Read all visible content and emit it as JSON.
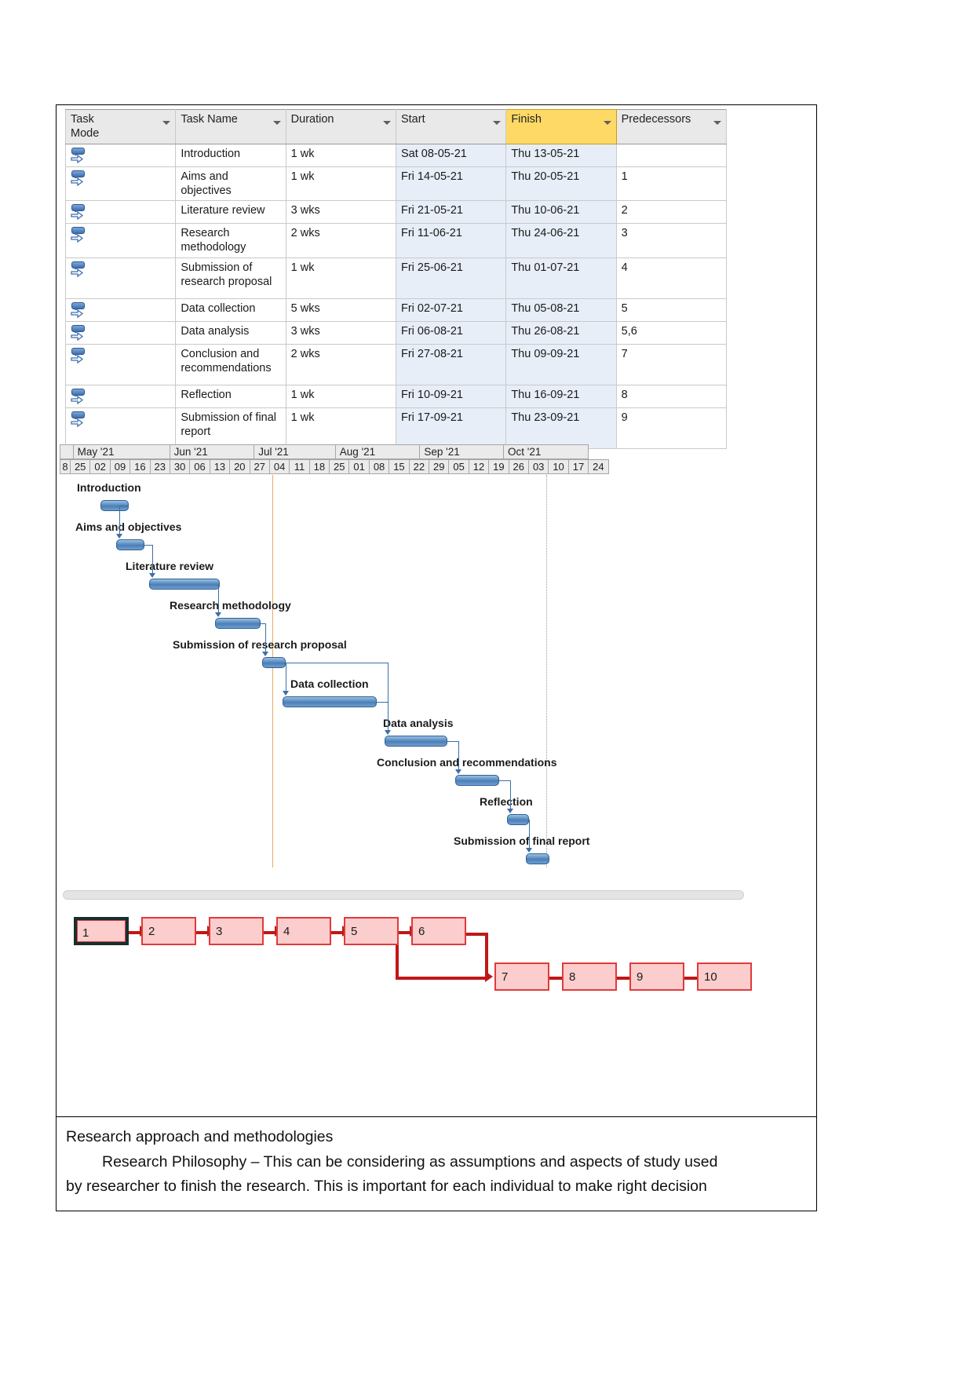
{
  "grid": {
    "columns": [
      {
        "label": "Task\nMode",
        "selected": false
      },
      {
        "label": "Task Name",
        "selected": false
      },
      {
        "label": "Duration",
        "selected": false
      },
      {
        "label": "Start",
        "selected": false
      },
      {
        "label": "Finish",
        "selected": true
      },
      {
        "label": "Predecessors",
        "selected": false
      }
    ],
    "rows": [
      {
        "name": "Introduction",
        "duration": "1 wk",
        "start": "Sat 08-05-21",
        "finish": "Thu 13-05-21",
        "pred": ""
      },
      {
        "name": "Aims and objectives",
        "duration": "1 wk",
        "start": "Fri 14-05-21",
        "finish": "Thu 20-05-21",
        "pred": "1"
      },
      {
        "name": "Literature review",
        "duration": "3 wks",
        "start": "Fri 21-05-21",
        "finish": "Thu 10-06-21",
        "pred": "2"
      },
      {
        "name": "Research methodology",
        "duration": "2 wks",
        "start": "Fri 11-06-21",
        "finish": "Thu 24-06-21",
        "pred": "3"
      },
      {
        "name": "Submission of research proposal",
        "duration": "1 wk",
        "start": "Fri 25-06-21",
        "finish": "Thu 01-07-21",
        "pred": "4"
      },
      {
        "name": "Data collection",
        "duration": "5 wks",
        "start": "Fri 02-07-21",
        "finish": "Thu 05-08-21",
        "pred": "5"
      },
      {
        "name": "Data analysis",
        "duration": "3 wks",
        "start": "Fri 06-08-21",
        "finish": "Thu 26-08-21",
        "pred": "5,6"
      },
      {
        "name": "Conclusion and recommendations",
        "duration": "2 wks",
        "start": "Fri 27-08-21",
        "finish": "Thu 09-09-21",
        "pred": "7"
      },
      {
        "name": "Reflection",
        "duration": "1 wk",
        "start": "Fri 10-09-21",
        "finish": "Thu 16-09-21",
        "pred": "8"
      },
      {
        "name": "Submission of final report",
        "duration": "1 wk",
        "start": "Fri 17-09-21",
        "finish": "Thu 23-09-21",
        "pred": "9"
      }
    ]
  },
  "gantt": {
    "months": [
      "May '21",
      "Jun '21",
      "Jul '21",
      "Aug '21",
      "Sep '21",
      "Oct '21"
    ],
    "weeks": [
      "8",
      "25",
      "02",
      "09",
      "16",
      "23",
      "30",
      "06",
      "13",
      "20",
      "27",
      "04",
      "11",
      "18",
      "25",
      "01",
      "08",
      "15",
      "22",
      "29",
      "05",
      "12",
      "19",
      "26",
      "03",
      "10",
      "17",
      "24"
    ],
    "bars": [
      {
        "label": "Introduction",
        "duration": "1 wk"
      },
      {
        "label": "Aims and objectives",
        "duration": "1 wk"
      },
      {
        "label": "Literature review",
        "duration": "3 wks"
      },
      {
        "label": "Research methodology",
        "duration": "2 wks"
      },
      {
        "label": "Submission of research proposal",
        "duration": "1 wk"
      },
      {
        "label": "Data collection",
        "duration": "5 wks"
      },
      {
        "label": "Data analysis",
        "duration": "3 wks"
      },
      {
        "label": "Conclusion and recommendations",
        "duration": "2 wks"
      },
      {
        "label": "Reflection",
        "duration": "1 wk"
      },
      {
        "label": "Submission of final report",
        "duration": "1 wk"
      }
    ],
    "colors": {
      "bar": "#4a7fb5",
      "bar_border": "#2e5f93",
      "link": "#3b6ea5",
      "today_line": "#e8a964"
    }
  },
  "network": {
    "nodes": [
      "1",
      "2",
      "3",
      "4",
      "5",
      "6",
      "7",
      "8",
      "9",
      "10"
    ],
    "colors": {
      "fill": "#fbcdcd",
      "border": "#e03b3b",
      "link": "#c01717",
      "selected_border": "#16302f"
    }
  },
  "text": {
    "heading": "Research approach and methodologies",
    "paragraph1": "Research Philosophy –  This can be considering as assumptions and aspects of study used",
    "paragraph2": "by researcher to finish the research. This is important for each individual to make right decision"
  }
}
